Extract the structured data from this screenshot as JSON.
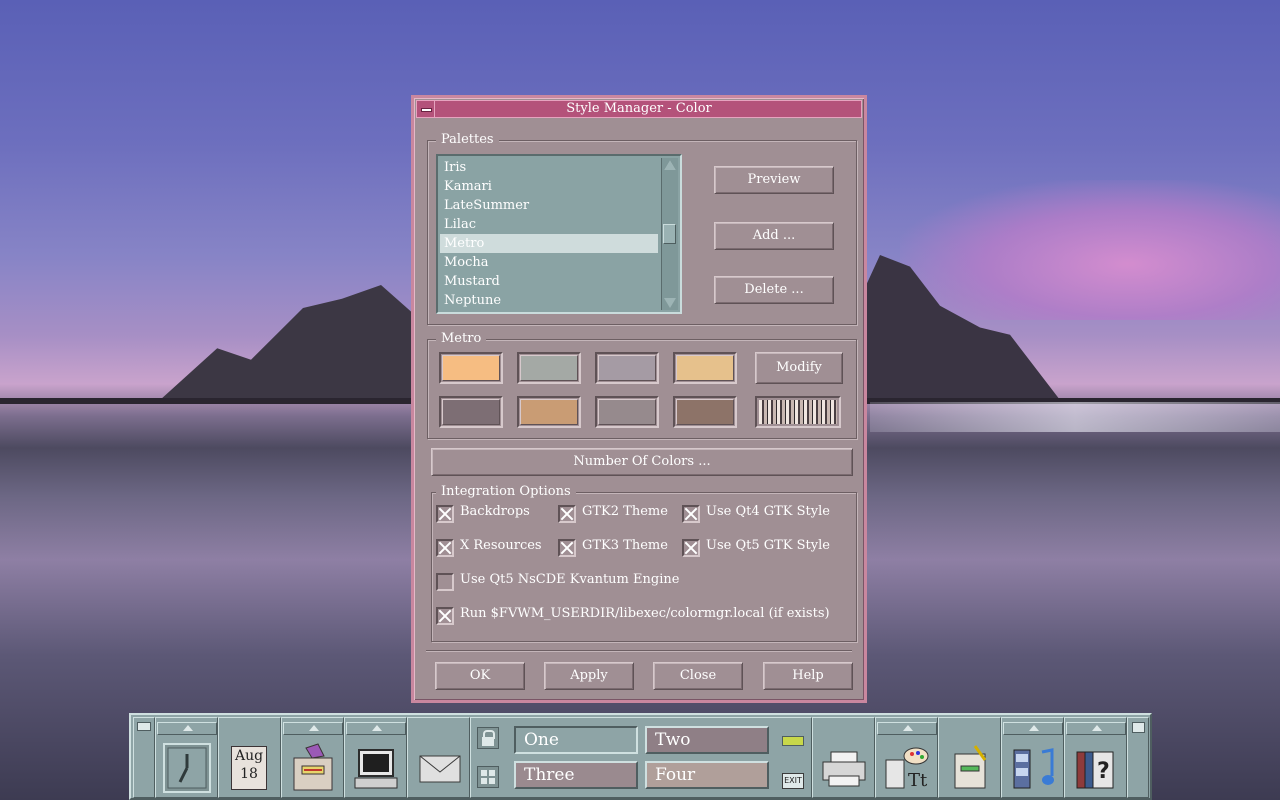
{
  "window": {
    "title": "Style Manager - Color",
    "palettes_label": "Palettes",
    "palettes": [
      "Iris",
      "Kamari",
      "LateSummer",
      "Lilac",
      "Metro",
      "Mocha",
      "Mustard",
      "Neptune"
    ],
    "selected_palette": "Metro",
    "preview_label": "Preview",
    "add_label": "Add ...",
    "delete_label": "Delete ...",
    "current_palette_label": "Metro",
    "swatch_colors": [
      "#f6bd82",
      "#a4a9a5",
      "#a59ba4",
      "#e6c18c",
      "#7d6e74",
      "#c99c74",
      "#968a8d",
      "#8d7368"
    ],
    "modify_label": "Modify",
    "number_of_colors_label": "Number Of Colors ...",
    "integration_label": "Integration Options",
    "options": {
      "backdrops": {
        "label": "Backdrops",
        "checked": true
      },
      "gtk2_theme": {
        "label": "GTK2 Theme",
        "checked": true
      },
      "qt4_gtk": {
        "label": "Use Qt4 GTK Style",
        "checked": true
      },
      "x_resources": {
        "label": "X Resources",
        "checked": true
      },
      "gtk3_theme": {
        "label": "GTK3 Theme",
        "checked": true
      },
      "qt5_gtk": {
        "label": "Use Qt5 GTK Style",
        "checked": true
      },
      "kvantum": {
        "label": "Use Qt5 NsCDE Kvantum Engine",
        "checked": false
      },
      "colormgr": {
        "label": "Run $FVWM_USERDIR/libexec/colormgr.local (if exists)",
        "checked": true
      }
    },
    "ok_label": "OK",
    "apply_label": "Apply",
    "close_label": "Close",
    "help_label": "Help"
  },
  "panel": {
    "calendar_month": "Aug",
    "calendar_day": "18",
    "workspaces": [
      "One",
      "Two",
      "Three",
      "Four"
    ],
    "active_workspace": "One",
    "exit_label": "EXIT",
    "icons": [
      "clock-icon",
      "calendar-icon",
      "file-manager-icon",
      "terminal-icon",
      "mail-icon",
      "lock-icon",
      "window-list-icon",
      "printer-icon",
      "style-manager-icon",
      "text-editor-icon",
      "media-icon",
      "help-icon"
    ]
  }
}
